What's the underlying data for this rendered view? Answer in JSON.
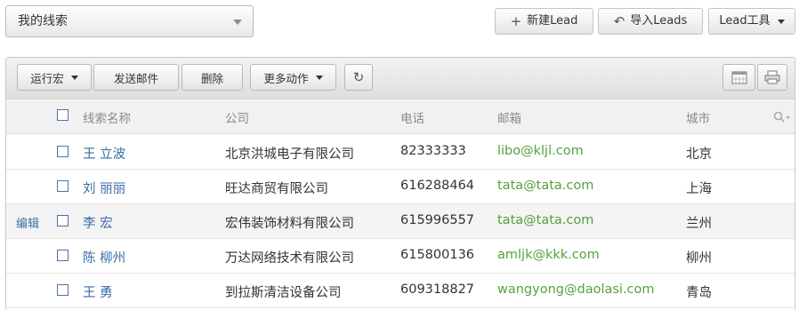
{
  "view": {
    "selected": "我的线索"
  },
  "toolbar": {
    "new_lead": "新建Lead",
    "import_leads": "导入Leads",
    "lead_tools": "Lead工具"
  },
  "actions": {
    "run_macro": "运行宏",
    "send_email": "发送邮件",
    "delete": "删除",
    "more_actions": "更多动作"
  },
  "table": {
    "columns": [
      "线索名称",
      "公司",
      "电话",
      "邮箱",
      "城市"
    ],
    "edit_label": "编辑",
    "rows": [
      {
        "name": "王 立波",
        "company": "北京洪城电子有限公司",
        "phone": "82333333",
        "email": "libo@kljl.com",
        "city": "北京"
      },
      {
        "name": "刘 丽丽",
        "company": "旺达商贸有限公司",
        "phone": "616288464",
        "email": "tata@tata.com",
        "city": "上海"
      },
      {
        "name": "李 宏",
        "company": "宏伟装饰材料有限公司",
        "phone": "615996557",
        "email": "tata@tata.com",
        "city": "兰州"
      },
      {
        "name": "陈 柳州",
        "company": "万达网络技术有限公司",
        "phone": "615800136",
        "email": "amljk@kkk.com",
        "city": "柳州"
      },
      {
        "name": "王 勇",
        "company": "到拉斯清洁设备公司",
        "phone": "609318827",
        "email": "wangyong@daolasi.com",
        "city": "青岛"
      }
    ]
  },
  "colors": {
    "link": "#3a6ea5",
    "email": "#55a13a",
    "checkbox": "#4a74a8"
  }
}
